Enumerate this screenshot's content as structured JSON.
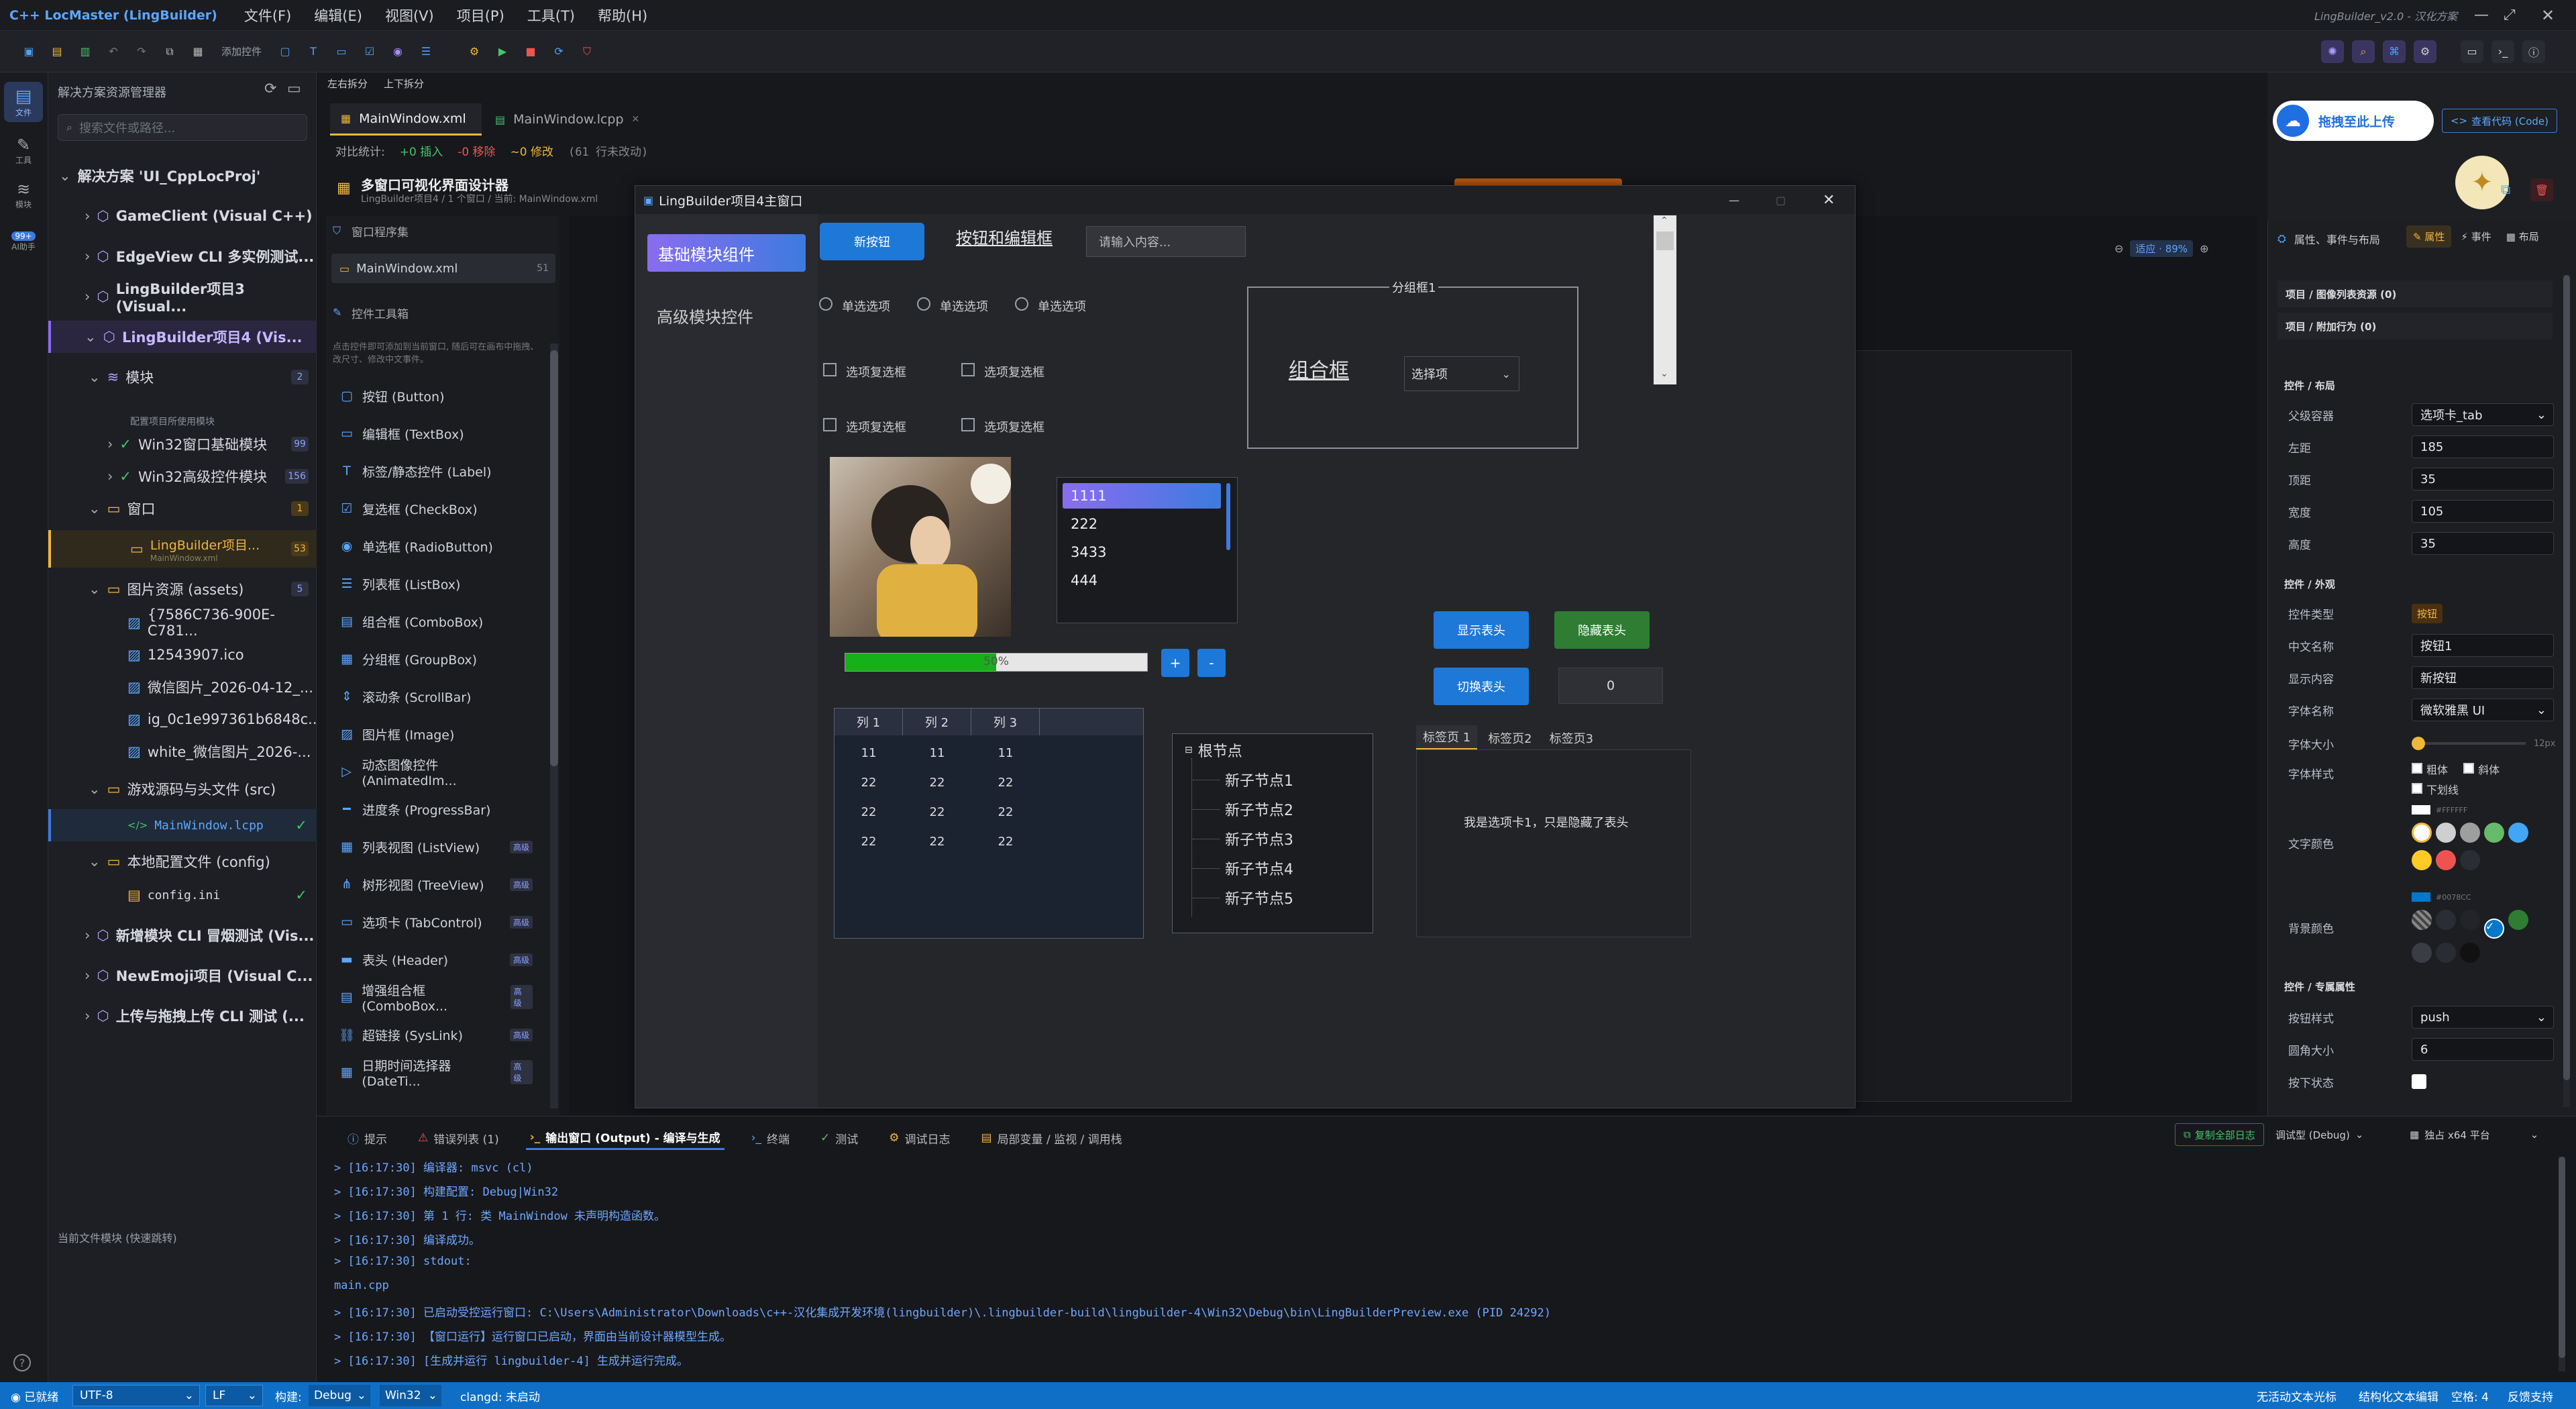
{
  "app": {
    "title": "C++ LocMaster (LingBuilder)",
    "version": "LingBuilder_v2.0 - 汉化方案",
    "menu": [
      "文件(F)",
      "编辑(E)",
      "视图(V)",
      "项目(P)",
      "工具(T)",
      "帮助(H)"
    ]
  },
  "toolbar": {
    "add_control": "添加控件",
    "split_lr": "左右拆分",
    "split_tb": "上下拆分"
  },
  "activity": {
    "items": [
      "文件",
      "工具",
      "模块",
      "AI助手"
    ],
    "badge": "99+"
  },
  "sidebar": {
    "title": "解决方案资源管理器",
    "search_placeholder": "搜索文件或路径...",
    "solution": "解决方案 'UI_CppLocProj'",
    "projects": [
      {
        "label": "GameClient (Visual C++)"
      },
      {
        "label": "EdgeView CLI 多实例测试..."
      },
      {
        "label": "LingBuilder项目3 (Visual..."
      },
      {
        "label": "LingBuilder项目4 (Vis..."
      }
    ],
    "module_folder": "模块",
    "module_count": "2",
    "module_hint": "配置项目所使用模块",
    "modules": [
      {
        "label": "Win32窗口基础模块",
        "count": "99"
      },
      {
        "label": "Win32高级控件模块",
        "count": "156"
      }
    ],
    "window_folder": "窗口",
    "window_count": "1",
    "window_item": "LingBuilder项目...",
    "window_file": "MainWindow.xml",
    "window_badge": "53",
    "assets_folder": "图片资源 (assets)",
    "assets_count": "5",
    "assets": [
      "{7586C736-900E-C781...",
      "12543907.ico",
      "微信图片_2026-04-12_...",
      "ig_0c1e997361b6848c...",
      "white_微信图片_2026-..."
    ],
    "src_folder": "游戏源码与头文件 (src)",
    "src_file": "MainWindow.lcpp",
    "config_folder": "本地配置文件 (config)",
    "config_file": "config.ini",
    "more_projects": [
      "新增模块 CLI 冒烟测试 (Vis...",
      "NewEmoji项目 (Visual C...",
      "上传与拖拽上传 CLI 测试 (..."
    ],
    "footer": "当前文件模块 (快速跳转)"
  },
  "tabs": [
    {
      "label": "MainWindow.xml"
    },
    {
      "label": "MainWindow.lcpp"
    }
  ],
  "diff": {
    "label": "对比统计:",
    "insert": "+0 插入",
    "remove": "-0 移除",
    "modify": "~0 修改",
    "unchanged": "(61 行未改动)"
  },
  "designer": {
    "title": "多窗口可视化界面设计器",
    "subtitle": "LingBuilder项目4 / 1 个窗口 / 当前: MainWindow.xml"
  },
  "window_list": {
    "title": "窗口程序集",
    "item": "MainWindow.xml",
    "count": "51"
  },
  "toolbox": {
    "title": "控件工具箱",
    "hint": "点击控件即可添加到当前窗口, 随后可在画布中拖拽、改尺寸、修改中文事件。",
    "items": [
      {
        "label": "按钮 (Button)"
      },
      {
        "label": "编辑框 (TextBox)"
      },
      {
        "label": "标签/静态控件 (Label)"
      },
      {
        "label": "复选框 (CheckBox)"
      },
      {
        "label": "单选框 (RadioButton)"
      },
      {
        "label": "列表框 (ListBox)"
      },
      {
        "label": "组合框 (ComboBox)"
      },
      {
        "label": "分组框 (GroupBox)"
      },
      {
        "label": "滚动条 (ScrollBar)"
      },
      {
        "label": "图片框 (Image)"
      },
      {
        "label": "动态图像控件 (AnimatedIm..."
      },
      {
        "label": "进度条 (ProgressBar)"
      },
      {
        "label": "列表视图 (ListView)"
      },
      {
        "label": "树形视图 (TreeView)"
      },
      {
        "label": "选项卡 (TabControl)"
      },
      {
        "label": "表头 (Header)"
      },
      {
        "label": "增强组合框 (ComboBox..."
      },
      {
        "label": "超链接 (SysLink)"
      },
      {
        "label": "日期时间选择器 (DateTi..."
      }
    ],
    "badge": "高级"
  },
  "upload": {
    "label": "拖拽至此上传",
    "view_code": "查看代码 (Code)"
  },
  "zoom": {
    "label": "适应 · 89%"
  },
  "preview": {
    "title": "LingBuilder项目4主窗口",
    "nav_basic": "基础模块组件",
    "nav_advanced": "高级模块控件",
    "new_button": "新按钮",
    "link": "按钮和编辑框",
    "edit_placeholder": "请输入内容...",
    "radios": [
      "单选选项",
      "单选选项",
      "单选选项"
    ],
    "checks": [
      "选项复选框",
      "选项复选框",
      "选项复选框",
      "选项复选框"
    ],
    "group_title": "分组框1",
    "combo_label": "组合框",
    "combo_select": "选择项",
    "list": [
      "1111",
      "222",
      "3433",
      "444"
    ],
    "progress": 0.5,
    "progress_label": "50%",
    "plus": "+",
    "minus": "-",
    "show_header": "显示表头",
    "hide_header": "隐藏表头",
    "toggle_header": "切换表头",
    "number": "0",
    "table": {
      "headers": [
        "列 1",
        "列 2",
        "列 3"
      ],
      "rows": [
        [
          "11",
          "11",
          "11"
        ],
        [
          "22",
          "22",
          "22"
        ],
        [
          "22",
          "22",
          "22"
        ],
        [
          "22",
          "22",
          "22"
        ]
      ]
    },
    "tree": {
      "root": "根节点",
      "children": [
        "新子节点1",
        "新子节点2",
        "新子节点3",
        "新子节点4",
        "新子节点5"
      ]
    },
    "tabs": [
      "标签页 1",
      "标签页2",
      "标签页3"
    ],
    "tab_content": "我是选项卡1，只是隐藏了表头"
  },
  "props": {
    "tabs": [
      "属性、事件与布局",
      "属性",
      "事件",
      "布局"
    ],
    "sec_resources": "项目 / 图像列表资源 (0)",
    "sec_extra": "项目 / 附加行为 (0)",
    "sec_layout": "控件 / 布局",
    "parent_label": "父级容器",
    "parent_value": "选项卡_tab",
    "left_label": "左距",
    "left_value": "185",
    "top_label": "顶距",
    "top_value": "35",
    "width_label": "宽度",
    "width_value": "105",
    "height_label": "高度",
    "height_value": "35",
    "sec_look": "控件 / 外观",
    "type_label": "控件类型",
    "type_value": "按钮",
    "cn_label": "中文名称",
    "cn_value": "按钮1",
    "content_label": "显示内容",
    "content_value": "新按钮",
    "font_label": "字体名称",
    "font_value": "微软雅黑 UI",
    "size_label": "字体大小",
    "size_value": "12px",
    "style_label": "字体样式",
    "bold": "粗体",
    "italic": "斜体",
    "underline": "下划线",
    "text_color_label": "文字颜色",
    "text_color_value": "#FFFFFF",
    "bg_color_label": "背景颜色",
    "bg_color_value": "#0078CC",
    "sec_special": "控件 / 专属属性",
    "btn_style_label": "按钮样式",
    "btn_style_value": "push",
    "radius_label": "圆角大小",
    "radius_value": "6",
    "pressed_label": "按下状态"
  },
  "bottom": {
    "tabs": [
      "提示",
      "错误列表 (1)",
      "输出窗口 (Output) - 编译与生成",
      "终端",
      "测试",
      "调试日志",
      "局部变量 / 监视 / 调用栈"
    ],
    "copy_log": "复制全部日志",
    "config": "调试型 (Debug)",
    "platform": "独占 x64 平台",
    "lines": [
      "> [16:17:30] 编译器: msvc (cl)",
      "> [16:17:30] 构建配置: Debug|Win32",
      "> [16:17:30] 第 1 行: 类 MainWindow 未声明构造函数。",
      "> [16:17:30] 编译成功。",
      "> [16:17:30] stdout:",
      "main.cpp",
      "> [16:17:30] 已启动受控运行窗口: C:\\Users\\Administrator\\Downloads\\c++-汉化集成开发环境(lingbuilder)\\.lingbuilder-build\\lingbuilder-4\\Win32\\Debug\\bin\\LingBuilderPreview.exe (PID 24292)",
      "> [16:17:30] 【窗口运行】运行窗口已启动，界面由当前设计器模型生成。",
      "> [16:17:30] [生成并运行 lingbuilder-4] 生成并运行完成。"
    ]
  },
  "status": {
    "ready": "已就绪",
    "encoding": "UTF-8",
    "eol": "LF",
    "build_label": "构建:",
    "build": "Debug",
    "platform": "Win32",
    "clangd": "clangd: 未启动",
    "right1": "无活动文本光标",
    "right2": "结构化文本编辑",
    "right3": "空格: 4",
    "right4": "反馈支持"
  },
  "colors": {
    "accent": "#3d7be0",
    "purple": "#8a6cf0",
    "bg": "#1e1f22"
  }
}
